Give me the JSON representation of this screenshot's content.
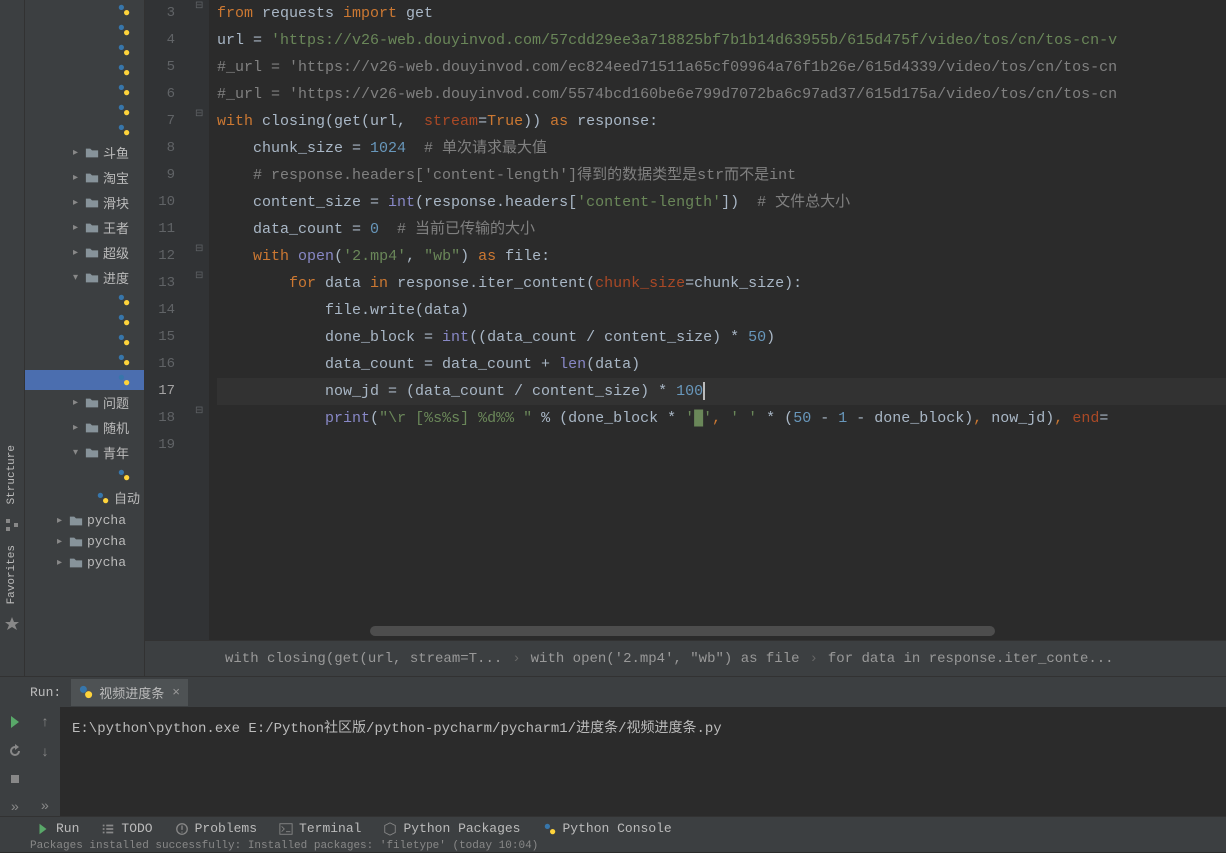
{
  "side_tools": {
    "structure": "Structure",
    "favorites": "Favorites"
  },
  "tree": {
    "items": [
      {
        "type": "py",
        "indent": 5,
        "label": ""
      },
      {
        "type": "py",
        "indent": 5,
        "label": ""
      },
      {
        "type": "py",
        "indent": 5,
        "label": ""
      },
      {
        "type": "py",
        "indent": 5,
        "label": ""
      },
      {
        "type": "py",
        "indent": 5,
        "label": ""
      },
      {
        "type": "py",
        "indent": 5,
        "label": ""
      },
      {
        "type": "py",
        "indent": 5,
        "label": ""
      },
      {
        "type": "folder",
        "indent": 3,
        "arrow": "right",
        "label": "斗鱼"
      },
      {
        "type": "folder",
        "indent": 3,
        "arrow": "right",
        "label": "淘宝"
      },
      {
        "type": "folder",
        "indent": 3,
        "arrow": "right",
        "label": "滑块"
      },
      {
        "type": "folder",
        "indent": 3,
        "arrow": "right",
        "label": "王者"
      },
      {
        "type": "folder",
        "indent": 3,
        "arrow": "right",
        "label": "超级"
      },
      {
        "type": "folder",
        "indent": 3,
        "arrow": "down",
        "label": "进度"
      },
      {
        "type": "py",
        "indent": 5,
        "label": ""
      },
      {
        "type": "py",
        "indent": 5,
        "label": ""
      },
      {
        "type": "py",
        "indent": 5,
        "label": ""
      },
      {
        "type": "py",
        "indent": 5,
        "label": ""
      },
      {
        "type": "py",
        "indent": 5,
        "label": "",
        "selected": true
      },
      {
        "type": "folder",
        "indent": 3,
        "arrow": "right",
        "label": "问题"
      },
      {
        "type": "folder",
        "indent": 3,
        "arrow": "right",
        "label": "随机"
      },
      {
        "type": "folder",
        "indent": 3,
        "arrow": "down",
        "label": "青年"
      },
      {
        "type": "py",
        "indent": 5,
        "label": ""
      },
      {
        "type": "py",
        "indent": 4,
        "label": "自动"
      },
      {
        "type": "folder",
        "indent": 2,
        "arrow": "right",
        "label": "pycha"
      },
      {
        "type": "folder",
        "indent": 2,
        "arrow": "right",
        "label": "pycha"
      },
      {
        "type": "folder",
        "indent": 2,
        "arrow": "right",
        "label": "pycha"
      }
    ]
  },
  "editor": {
    "lines": [
      3,
      4,
      5,
      6,
      7,
      8,
      9,
      10,
      11,
      12,
      13,
      14,
      15,
      16,
      17,
      18,
      19
    ],
    "current_line": 17,
    "code": {
      "l3": {
        "import_kw": "from",
        "mod": "requests",
        "import2": "import",
        "name": "get"
      },
      "l4": {
        "var": "url = ",
        "str": "'https://v26-web.douyinvod.com/57cdd29ee3a718825bf7b1b14d63955b/615d475f/video/tos/cn/tos-cn-v"
      },
      "l5": {
        "com": "#_url = 'https://v26-web.douyinvod.com/ec824eed71511a65cf09964a76f1b26e/615d4339/video/tos/cn/tos-cn"
      },
      "l6": {
        "com": "#_url = 'https://v26-web.douyinvod.com/5574bcd160be6e799d7072ba6c97ad37/615d175a/video/tos/cn/tos-cn"
      },
      "l7": {
        "with": "with",
        "closing": "closing",
        "get": "get",
        "url": "url",
        "stream": "stream",
        "true": "True",
        "as": "as",
        "resp": "response:"
      },
      "l8": {
        "var": "chunk_size = ",
        "num": "1024",
        "com": "  # 单次请求最大值"
      },
      "l9": {
        "com": "# response.headers['content-length']得到的数据类型是str而不是int"
      },
      "l10": {
        "var": "content_size = ",
        "int": "int",
        "p": "(response.headers[",
        "str": "'content-length'",
        "p2": "])",
        "com": "  # 文件总大小"
      },
      "l11": {
        "var": "data_count = ",
        "num": "0",
        "com": "  # 当前已传输的大小"
      },
      "l12": {
        "with": "with",
        "open": "open",
        "p": "(",
        "str1": "'2.mp4'",
        "c": ", ",
        "str2": "\"wb\"",
        "p2": ") ",
        "as": "as",
        "file": " file:"
      },
      "l13": {
        "for": "for",
        "data": " data ",
        "in": "in",
        "resp": " response.iter_content(",
        "param": "chunk_size",
        "eq": "=chunk_size):"
      },
      "l14": {
        "txt": "file.write(data)"
      },
      "l15": {
        "var": "done_block = ",
        "int": "int",
        "p": "((data_count / content_size) * ",
        "num": "50",
        "p2": ")"
      },
      "l16": {
        "var": "data_count = data_count + ",
        "len": "len",
        "p": "(data)"
      },
      "l17": {
        "var": "now_jd = (data_count / content_size) * ",
        "num": "100"
      },
      "l18": {
        "print": "print",
        "p": "(",
        "str": "\"\\r [%s%s] %d%% \"",
        "pct": " % (done_block * ",
        "str2": "'█'",
        "c": ", ",
        "str3": "' '",
        "m": " * (",
        "n1": "50",
        "m2": " - ",
        "n2": "1",
        "m3": " - done_block)",
        ",": ", ",
        "nj": "now_jd)",
        ",2": ", ",
        "end": "end",
        "eq": "="
      }
    }
  },
  "breadcrumb": {
    "seg1": "with closing(get(url, stream=T...",
    "seg2": "with open('2.mp4', \"wb\") as file",
    "seg3": "for data in response.iter_conte...",
    "sep": "›"
  },
  "run": {
    "label": "Run:",
    "tab": "视频进度条",
    "output": "E:\\python\\python.exe E:/Python社区版/python-pycharm/pycharm1/进度条/视频进度条.py"
  },
  "bottom_tabs": {
    "run": "Run",
    "todo": "TODO",
    "problems": "Problems",
    "terminal": "Terminal",
    "packages": "Python Packages",
    "console": "Python Console"
  },
  "status": "Packages installed successfully: Installed packages: 'filetype' (today 10:04)"
}
